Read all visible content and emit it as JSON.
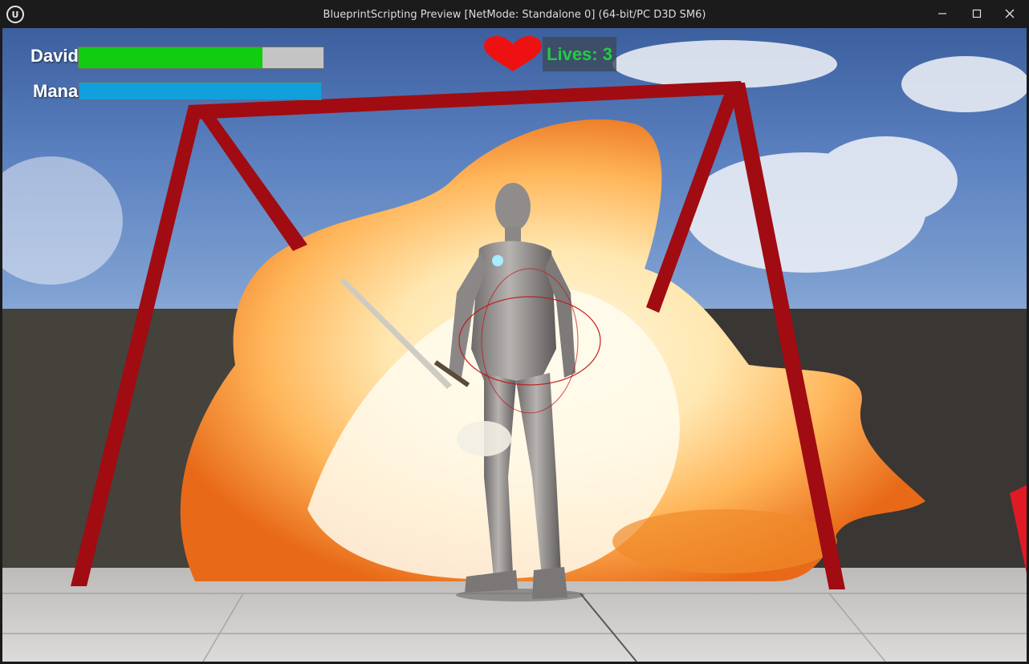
{
  "window": {
    "title": "BlueprintScripting Preview [NetMode: Standalone 0]  (64-bit/PC D3D SM6)",
    "logo": "unreal-engine-logo",
    "controls": [
      "minimize-icon",
      "maximize-icon",
      "close-icon"
    ]
  },
  "hud": {
    "player_name": "David",
    "health_fraction": 0.75,
    "health_color": "#11cc11",
    "mana_label": "Mana",
    "mana_fraction": 1.0,
    "mana_color": "#12a0dc",
    "lives_text": "Lives: 3",
    "lives_color": "#22cc44",
    "heart_color": "#ee1111"
  },
  "scene": {
    "description_icons": [
      "red-frame",
      "fire-explosion",
      "armored-character",
      "sword"
    ]
  }
}
